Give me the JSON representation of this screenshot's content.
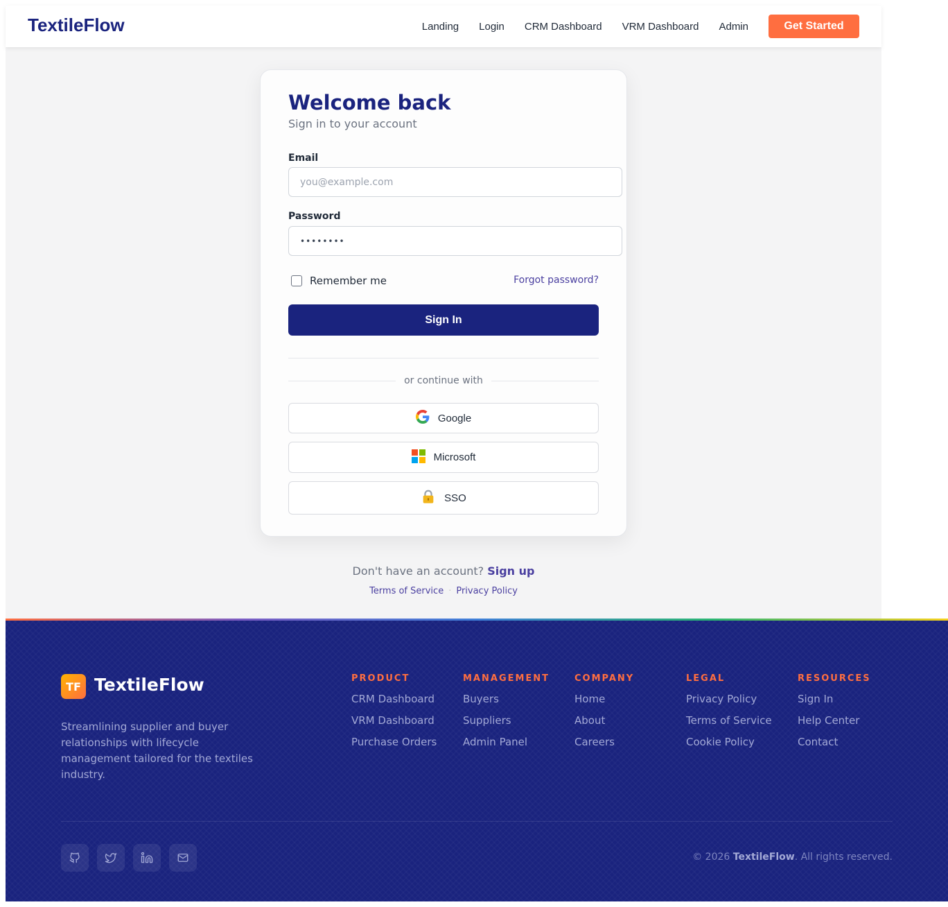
{
  "nav": {
    "brand": "TextileFlow",
    "links": [
      "Landing",
      "Login",
      "CRM Dashboard",
      "VRM Dashboard",
      "Admin"
    ],
    "cta": "Get Started"
  },
  "login": {
    "title": "Welcome back",
    "subtitle": "Sign in to your account",
    "email_label": "Email",
    "email_placeholder": "you@example.com",
    "password_label": "Password",
    "password_value": "••••••••",
    "remember": "Remember me",
    "forgot": "Forgot password?",
    "submit": "Sign In",
    "divider": "or continue with",
    "social": [
      {
        "label": "Google",
        "icon": "google-icon"
      },
      {
        "label": "Microsoft",
        "icon": "microsoft-icon"
      },
      {
        "label": "SSO",
        "icon": "lock-icon"
      }
    ]
  },
  "below": {
    "question": "Don't have an account?",
    "signup": "Sign up",
    "terms": "Terms of Service",
    "privacy": "Privacy Policy"
  },
  "footer": {
    "logo_initials": "TF",
    "brand": "TextileFlow",
    "description": "Streamlining supplier and buyer relationships with lifecycle management tailored for the textiles industry.",
    "columns": [
      {
        "title": "PRODUCT",
        "items": [
          "CRM Dashboard",
          "VRM Dashboard",
          "Purchase Orders"
        ]
      },
      {
        "title": "MANAGEMENT",
        "items": [
          "Buyers",
          "Suppliers",
          "Admin Panel"
        ]
      },
      {
        "title": "COMPANY",
        "items": [
          "Home",
          "About",
          "Careers"
        ]
      },
      {
        "title": "LEGAL",
        "items": [
          "Privacy Policy",
          "Terms of Service",
          "Cookie Policy"
        ]
      },
      {
        "title": "RESOURCES",
        "items": [
          "Sign In",
          "Help Center",
          "Contact"
        ]
      }
    ],
    "social_icons": [
      "github-icon",
      "twitter-icon",
      "linkedin-icon",
      "mail-icon"
    ],
    "copyright_prefix": "© 2026 ",
    "copyright_brand": "TextileFlow",
    "copyright_suffix": ". All rights reserved."
  },
  "colors": {
    "primary": "#1a237e",
    "accent": "#ff6e40",
    "link": "#4a3fa0",
    "page_bg": "#f4f4f5"
  }
}
